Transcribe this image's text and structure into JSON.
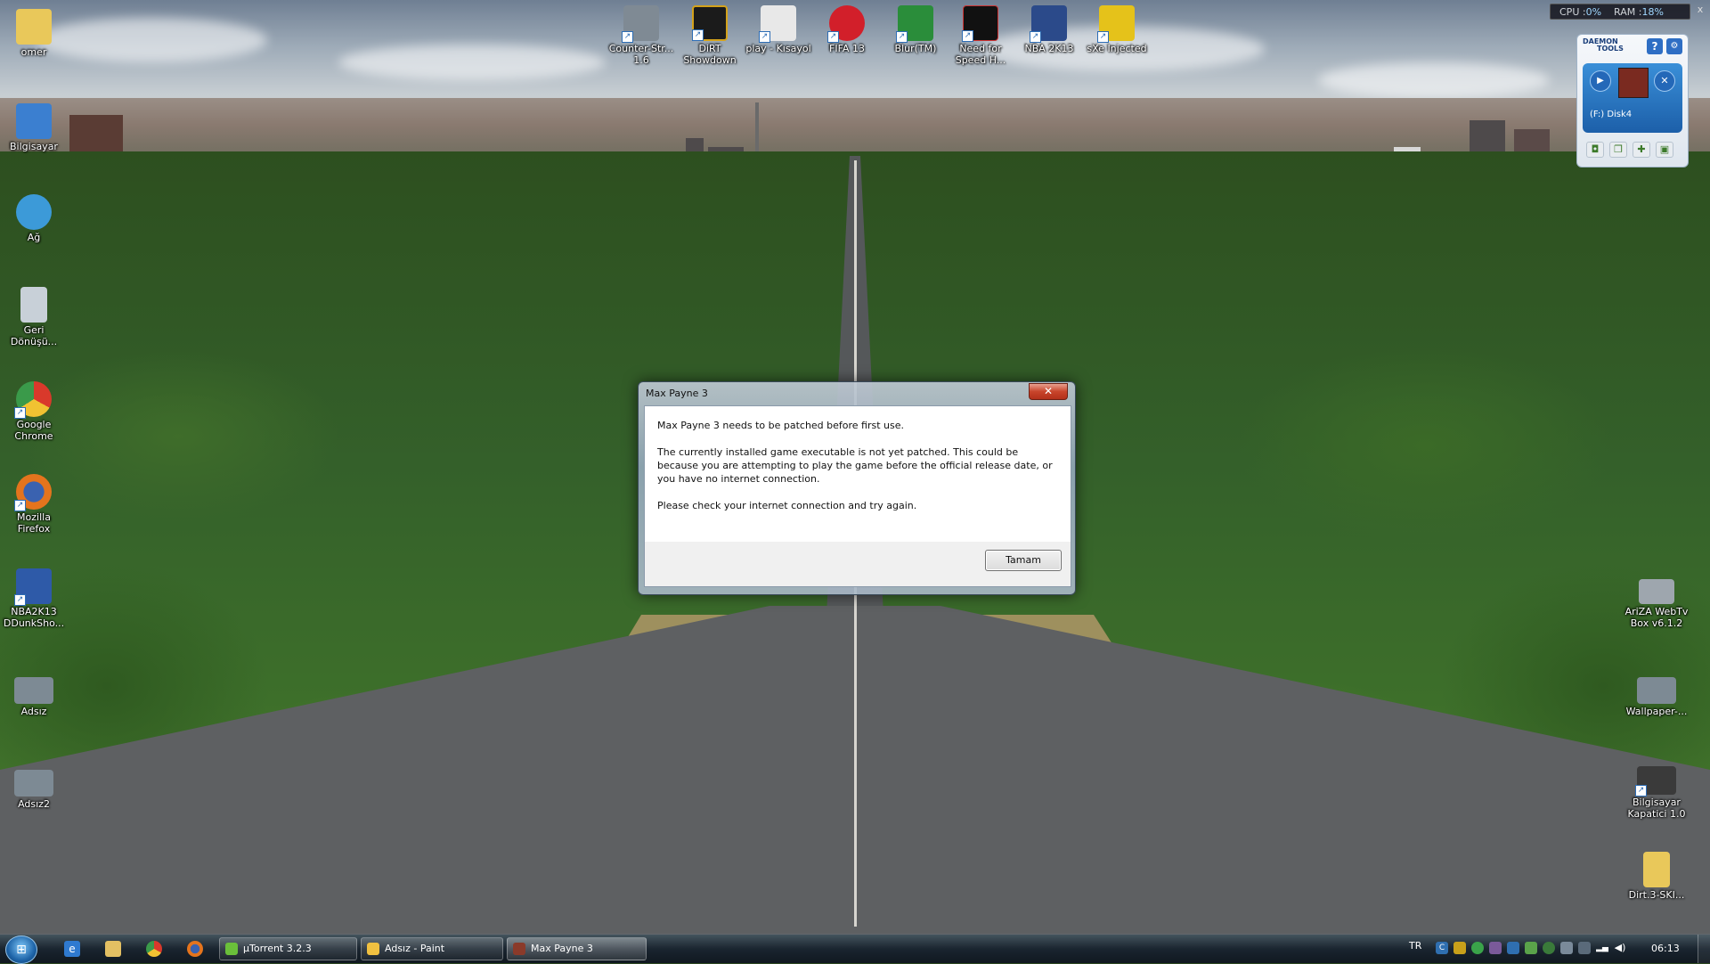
{
  "system_monitor": {
    "cpu_label": "CPU :",
    "cpu_value": "0%",
    "ram_label": "RAM :",
    "ram_value": "18%",
    "close": "x"
  },
  "daemon_tools": {
    "logo_line1": "DAEMON",
    "logo_line2": "TOOLS",
    "help": "?",
    "drive_label": "(F:) Disk4"
  },
  "desktop_icons_top": [
    {
      "label": "Counter-Str... 1.6",
      "color": "#7f8a94"
    },
    {
      "label": "DiRT Showdown",
      "color": "#1b1b1b"
    },
    {
      "label": "play - Kısayol",
      "color": "#e8e8e8"
    },
    {
      "label": "FIFA 13",
      "color": "#d21f2a"
    },
    {
      "label": "Blur(TM)",
      "color": "#2a8d3a"
    },
    {
      "label": "Need for Speed H...",
      "color": "#111111"
    },
    {
      "label": "NBA 2K13",
      "color": "#2b4a8a"
    },
    {
      "label": "sXe Injected",
      "color": "#e5c21a"
    }
  ],
  "desktop_icons_left": [
    {
      "label": "omer",
      "color": "#e9c85a"
    },
    {
      "label": "Bilgisayar",
      "color": "#3b7fd0"
    },
    {
      "label": "Ağ",
      "color": "#3c9ad8"
    },
    {
      "label": "Geri Dönüşü...",
      "color": "#c8d0d8"
    },
    {
      "label": "Google Chrome",
      "color": "#d9392b"
    },
    {
      "label": "Mozilla Firefox",
      "color": "#e4741d"
    },
    {
      "label": "NBA2K13 DDunkSho...",
      "color": "#2e5aa8"
    },
    {
      "label": "Adsız",
      "color": "#7d8a94"
    },
    {
      "label": "Adsız2",
      "color": "#7d8a94"
    }
  ],
  "desktop_icons_right": [
    {
      "label": "AriZA WebTv Box v6.1.2",
      "color": "#9ea6ae"
    },
    {
      "label": "Wallpaper-...",
      "color": "#7d8a94"
    },
    {
      "label": "Bilgisayar Kapatici 1.0",
      "color": "#3a3a3a"
    },
    {
      "label": "Dirt.3-SKI...",
      "color": "#e9c85a"
    }
  ],
  "dialog": {
    "title": "Max Payne 3",
    "close_symbol": "✕",
    "line1": "Max Payne 3 needs to be patched before first use.",
    "line2": "The currently installed game executable is not yet patched. This could be because you are attempting to play the game before the official release date, or you have no internet connection.",
    "line3": "Please check your internet connection and try again.",
    "ok_button": "Tamam"
  },
  "taskbar": {
    "start_symbol": "⊞",
    "tasks": [
      {
        "label": "µTorrent 3.2.3",
        "icon_color": "#6abf3a"
      },
      {
        "label": "Adsız - Paint",
        "icon_color": "#f0c040"
      },
      {
        "label": "Max Payne 3",
        "icon_color": "#8a3a2a"
      }
    ],
    "language": "TR",
    "clock": "06:13"
  }
}
